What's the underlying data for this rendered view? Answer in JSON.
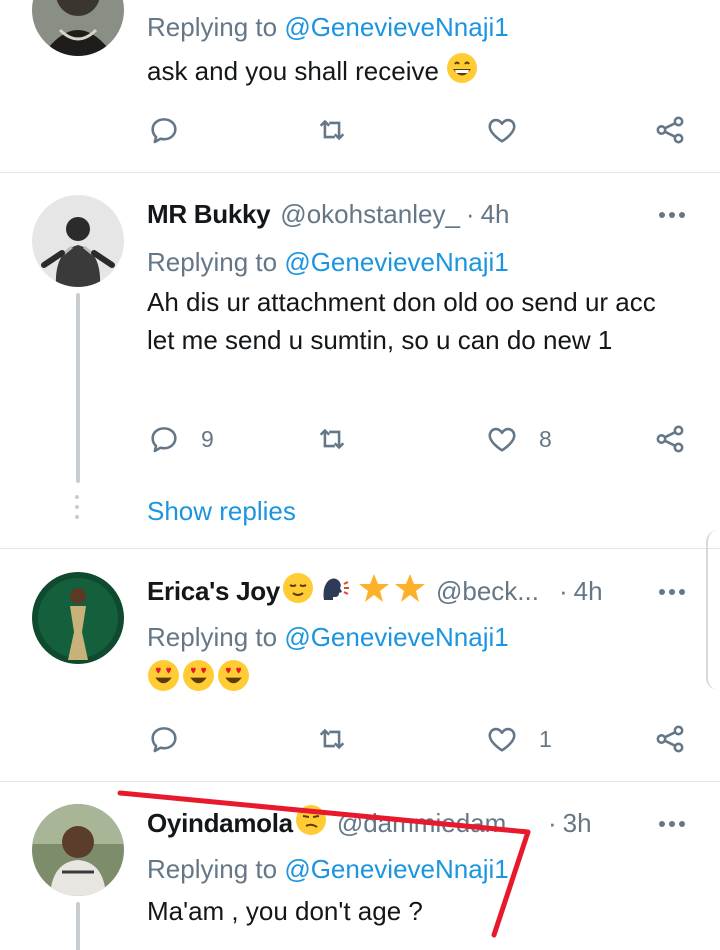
{
  "tweets": [
    {
      "name": "",
      "handle": "",
      "time": "",
      "replying_label": "Replying to",
      "replying_to": "@GenevieveNnaji1",
      "text": "ask and you shall receive",
      "text_emoji": "grinning-face",
      "reply_count": "",
      "like_count": ""
    },
    {
      "name": "MR Bukky",
      "handle": "@okohstanley_",
      "dot": "·",
      "time": "4h",
      "replying_label": "Replying to",
      "replying_to": "@GenevieveNnaji1",
      "text": "Ah dis ur attachment don old oo send ur acc let me send u sumtin, so u can do new 1",
      "reply_count": "9",
      "like_count": "8",
      "show_replies": "Show replies"
    },
    {
      "name": "Erica's Joy",
      "name_emojis": [
        "relieved-face",
        "speaking-head",
        "star",
        "star"
      ],
      "handle": "@beck...",
      "dot": "·",
      "time": "4h",
      "replying_label": "Replying to",
      "replying_to": "@GenevieveNnaji1",
      "text_emojis": [
        "heart-eyes",
        "heart-eyes",
        "heart-eyes"
      ],
      "reply_count": "",
      "like_count": "1"
    },
    {
      "name": "Oyindamola",
      "name_emojis": [
        "confused-face"
      ],
      "handle": "@dammiedam...",
      "dot": "·",
      "time": "3h",
      "replying_label": "Replying to",
      "replying_to": "@GenevieveNnaji1",
      "text": "Ma'am , you don't age ?"
    }
  ],
  "colors": {
    "link": "#1b95e0",
    "muted": "#657786",
    "text": "#14171a",
    "annotation": "#e8192c"
  }
}
